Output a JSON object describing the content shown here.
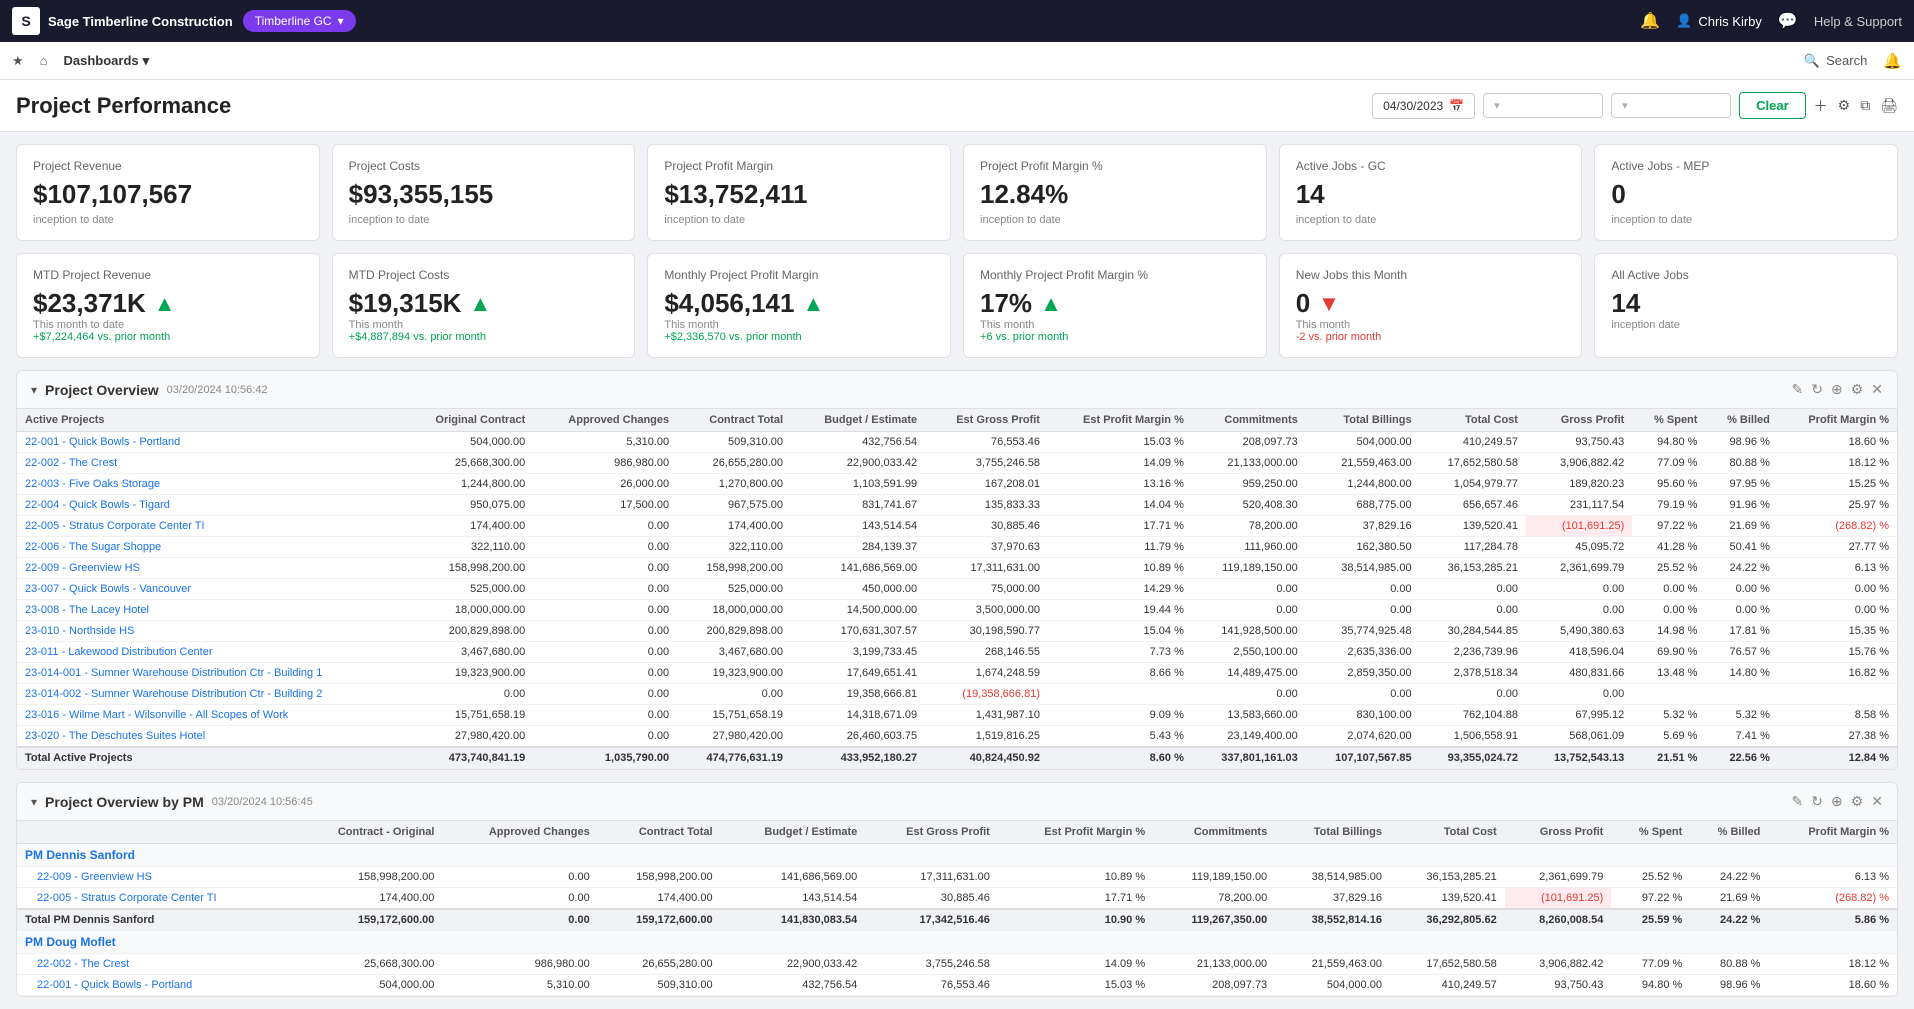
{
  "app": {
    "logo_text": "S",
    "company_name": "Sage Timberline Construction",
    "tenant": "Timberline GC"
  },
  "top_nav": {
    "notification_icon": "🔔",
    "user_icon": "👤",
    "chat_icon": "💬",
    "user_name": "Chris Kirby",
    "help_label": "Help & Support"
  },
  "sec_nav": {
    "star_icon": "★",
    "home_icon": "⌂",
    "dashboards_label": "Dashboards",
    "search_label": "Search",
    "notification_icon": "🔔"
  },
  "page": {
    "title": "Project Performance",
    "date_value": "04/30/2023",
    "clear_label": "Clear",
    "filter1_placeholder": "",
    "filter2_placeholder": ""
  },
  "kpi_row1": [
    {
      "label": "Project Revenue",
      "value": "$107,107,567",
      "sub": "inception to date"
    },
    {
      "label": "Project Costs",
      "value": "$93,355,155",
      "sub": "inception to date"
    },
    {
      "label": "Project Profit Margin",
      "value": "$13,752,411",
      "sub": "inception to date"
    },
    {
      "label": "Project Profit Margin %",
      "value": "12.84%",
      "sub": "inception to date"
    },
    {
      "label": "Active Jobs - GC",
      "value": "14",
      "sub": "inception to date"
    },
    {
      "label": "Active Jobs - MEP",
      "value": "0",
      "sub": "inception to date"
    }
  ],
  "kpi_row2": [
    {
      "label": "MTD Project Revenue",
      "value": "$23,371K",
      "trend": "up",
      "sub1": "This month to date",
      "sub2": "+$7,224,464 vs. prior month"
    },
    {
      "label": "MTD Project Costs",
      "value": "$19,315K",
      "trend": "up",
      "sub1": "This month",
      "sub2": "+$4,887,894 vs. prior month"
    },
    {
      "label": "Monthly Project Profit Margin",
      "value": "$4,056,141",
      "trend": "up",
      "sub1": "This month",
      "sub2": "+$2,336,570 vs. prior month"
    },
    {
      "label": "Monthly Project Profit Margin %",
      "value": "17%",
      "trend": "up",
      "sub1": "This month",
      "sub2": "+6 vs. prior month"
    },
    {
      "label": "New Jobs this Month",
      "value": "0",
      "trend": "down",
      "sub1": "This month",
      "sub2": "-2 vs. prior month"
    },
    {
      "label": "All Active Jobs",
      "value": "14",
      "trend": null,
      "sub1": "inception date",
      "sub2": ""
    }
  ],
  "project_overview": {
    "title": "Project Overview",
    "date": "03/20/2024 10:56:42",
    "columns": [
      "Original Contract",
      "Approved Changes",
      "Contract Total",
      "Budget / Estimate",
      "Est Gross Profit",
      "Est Profit Margin %",
      "Commitments",
      "Total Billings",
      "Total Cost",
      "Gross Profit",
      "% Spent",
      "% Billed",
      "Profit Margin %"
    ],
    "section_label": "Active Projects",
    "rows": [
      {
        "name": "22-001 - Quick Bowls - Portland",
        "link": true,
        "cols": [
          "504,000.00",
          "5,310.00",
          "509,310.00",
          "432,756.54",
          "76,553.46",
          "15.03 %",
          "208,097.73",
          "504,000.00",
          "410,249.57",
          "93,750.43",
          "94.80 %",
          "98.96 %",
          "18.60 %"
        ]
      },
      {
        "name": "22-002 - The Crest",
        "link": true,
        "cols": [
          "25,668,300.00",
          "986,980.00",
          "26,655,280.00",
          "22,900,033.42",
          "3,755,246.58",
          "14.09 %",
          "21,133,000.00",
          "21,559,463.00",
          "17,652,580.58",
          "3,906,882.42",
          "77.09 %",
          "80.88 %",
          "18.12 %"
        ]
      },
      {
        "name": "22-003 - Five Oaks Storage",
        "link": true,
        "cols": [
          "1,244,800.00",
          "26,000.00",
          "1,270,800.00",
          "1,103,591.99",
          "167,208.01",
          "13.16 %",
          "959,250.00",
          "1,244,800.00",
          "1,054,979.77",
          "189,820.23",
          "95.60 %",
          "97.95 %",
          "15.25 %"
        ]
      },
      {
        "name": "22-004 - Quick Bowls - Tigard",
        "link": true,
        "cols": [
          "950,075.00",
          "17,500.00",
          "967,575.00",
          "831,741.67",
          "135,833.33",
          "14.04 %",
          "520,408.30",
          "688,775.00",
          "656,657.46",
          "231,117.54",
          "79.19 %",
          "91.96 %",
          "25.97 %"
        ]
      },
      {
        "name": "22-005 - Stratus Corporate Center TI",
        "link": true,
        "highlight": true,
        "cols": [
          "174,400.00",
          "0.00",
          "174,400.00",
          "143,514.54",
          "30,885.46",
          "17.71 %",
          "78,200.00",
          "37,829.16",
          "139,520.41",
          "(101,691.25)",
          "97.22 %",
          "21.69 %",
          "(268.82) %"
        ]
      },
      {
        "name": "22-006 - The Sugar Shoppe",
        "link": true,
        "cols": [
          "322,110.00",
          "0.00",
          "322,110.00",
          "284,139.37",
          "37,970.63",
          "11.79 %",
          "111,960.00",
          "162,380.50",
          "117,284.78",
          "45,095.72",
          "41.28 %",
          "50.41 %",
          "27.77 %"
        ]
      },
      {
        "name": "22-009 - Greenview HS",
        "link": true,
        "cols": [
          "158,998,200.00",
          "0.00",
          "158,998,200.00",
          "141,686,569.00",
          "17,311,631.00",
          "10.89 %",
          "119,189,150.00",
          "38,514,985.00",
          "36,153,285.21",
          "2,361,699.79",
          "25.52 %",
          "24.22 %",
          "6.13 %"
        ]
      },
      {
        "name": "23-007 - Quick Bowls - Vancouver",
        "link": true,
        "cols": [
          "525,000.00",
          "0.00",
          "525,000.00",
          "450,000.00",
          "75,000.00",
          "14.29 %",
          "0.00",
          "0.00",
          "0.00",
          "0.00",
          "0.00 %",
          "0.00 %",
          "0.00 %"
        ]
      },
      {
        "name": "23-008 - The Lacey Hotel",
        "link": true,
        "cols": [
          "18,000,000.00",
          "0.00",
          "18,000,000.00",
          "14,500,000.00",
          "3,500,000.00",
          "19.44 %",
          "0.00",
          "0.00",
          "0.00",
          "0.00",
          "0.00 %",
          "0.00 %",
          "0.00 %"
        ]
      },
      {
        "name": "23-010 - Northside HS",
        "link": true,
        "cols": [
          "200,829,898.00",
          "0.00",
          "200,829,898.00",
          "170,631,307.57",
          "30,198,590.77",
          "15.04 %",
          "141,928,500.00",
          "35,774,925.48",
          "30,284,544.85",
          "5,490,380.63",
          "14.98 %",
          "17.81 %",
          "15.35 %"
        ]
      },
      {
        "name": "23-011 - Lakewood Distribution Center",
        "link": true,
        "cols": [
          "3,467,680.00",
          "0.00",
          "3,467,680.00",
          "3,199,733.45",
          "268,146.55",
          "7.73 %",
          "2,550,100.00",
          "2,635,336.00",
          "2,236,739.96",
          "418,596.04",
          "69.90 %",
          "76.57 %",
          "15.76 %"
        ]
      },
      {
        "name": "23-014-001 - Sumner Warehouse Distribution Ctr - Building 1",
        "link": true,
        "cols": [
          "19,323,900.00",
          "0.00",
          "19,323,900.00",
          "17,649,651.41",
          "1,674,248.59",
          "8.66 %",
          "14,489,475.00",
          "2,859,350.00",
          "2,378,518.34",
          "480,831.66",
          "13.48 %",
          "14.80 %",
          "16.82 %"
        ]
      },
      {
        "name": "23-014-002 - Sumner Warehouse Distribution Ctr - Building 2",
        "link": true,
        "cols": [
          "0.00",
          "0.00",
          "0.00",
          "19,358,666.81",
          "(19,358,666.81)",
          "",
          "0.00",
          "0.00",
          "0.00",
          "0.00",
          "",
          "",
          ""
        ]
      },
      {
        "name": "23-016 - Wilme Mart - Wilsonville - All Scopes of Work",
        "link": true,
        "cols": [
          "15,751,658.19",
          "0.00",
          "15,751,658.19",
          "14,318,671.09",
          "1,431,987.10",
          "9.09 %",
          "13,583,660.00",
          "830,100.00",
          "762,104.88",
          "67,995.12",
          "5.32 %",
          "5.32 %",
          "8.58 %"
        ]
      },
      {
        "name": "23-020 - The Deschutes Suites Hotel",
        "link": true,
        "cols": [
          "27,980,420.00",
          "0.00",
          "27,980,420.00",
          "26,460,603.75",
          "1,519,816.25",
          "5.43 %",
          "23,149,400.00",
          "2,074,620.00",
          "1,506,558.91",
          "568,061.09",
          "5.69 %",
          "7.41 %",
          "27.38 %"
        ]
      }
    ],
    "total_row": {
      "name": "Total Active Projects",
      "cols": [
        "473,740,841.19",
        "1,035,790.00",
        "474,776,631.19",
        "433,952,180.27",
        "40,824,450.92",
        "8.60 %",
        "337,801,161.03",
        "107,107,567.85",
        "93,355,024.72",
        "13,752,543.13",
        "21.51 %",
        "22.56 %",
        "12.84 %"
      ]
    }
  },
  "project_overview_pm": {
    "title": "Project Overview by PM",
    "date": "03/20/2024 10:56:45",
    "columns": [
      "Contract - Original",
      "Approved Changes",
      "Contract Total",
      "Budget / Estimate",
      "Est Gross Profit",
      "Est Profit Margin %",
      "Commitments",
      "Total Billings",
      "Total Cost",
      "Gross Profit",
      "% Spent",
      "% Billed",
      "Profit Margin %"
    ],
    "pm_groups": [
      {
        "pm_name": "PM Dennis Sanford",
        "rows": [
          {
            "name": "22-009 - Greenview HS",
            "link": true,
            "cols": [
              "158,998,200.00",
              "0.00",
              "158,998,200.00",
              "141,686,569.00",
              "17,311,631.00",
              "10.89 %",
              "119,189,150.00",
              "38,514,985.00",
              "36,153,285.21",
              "2,361,699.79",
              "25.52 %",
              "24.22 %",
              "6.13 %"
            ]
          },
          {
            "name": "22-005 - Stratus Corporate Center TI",
            "link": true,
            "highlight": true,
            "cols": [
              "174,400.00",
              "0.00",
              "174,400.00",
              "143,514.54",
              "30,885.46",
              "17.71 %",
              "78,200.00",
              "37,829.16",
              "139,520.41",
              "(101,691.25)",
              "97.22 %",
              "21.69 %",
              "(268.82) %"
            ]
          }
        ],
        "total": {
          "name": "Total PM Dennis Sanford",
          "cols": [
            "159,172,600.00",
            "0.00",
            "159,172,600.00",
            "141,830,083.54",
            "17,342,516.46",
            "10.90 %",
            "119,267,350.00",
            "38,552,814.16",
            "36,292,805.62",
            "8,260,008.54",
            "25.59 %",
            "24.22 %",
            "5.86 %"
          ]
        }
      },
      {
        "pm_name": "PM Doug Moflet",
        "rows": [
          {
            "name": "22-002 - The Crest",
            "link": true,
            "cols": [
              "25,668,300.00",
              "986,980.00",
              "26,655,280.00",
              "22,900,033.42",
              "3,755,246.58",
              "14.09 %",
              "21,133,000.00",
              "21,559,463.00",
              "17,652,580.58",
              "3,906,882.42",
              "77.09 %",
              "80.88 %",
              "18.12 %"
            ]
          },
          {
            "name": "22-001 - Quick Bowls - Portland",
            "link": true,
            "cols": [
              "504,000.00",
              "5,310.00",
              "509,310.00",
              "432,756.54",
              "76,553.46",
              "15.03 %",
              "208,097.73",
              "504,000.00",
              "410,249.57",
              "93,750.43",
              "94.80 %",
              "98.96 %",
              "18.60 %"
            ]
          }
        ]
      }
    ]
  }
}
